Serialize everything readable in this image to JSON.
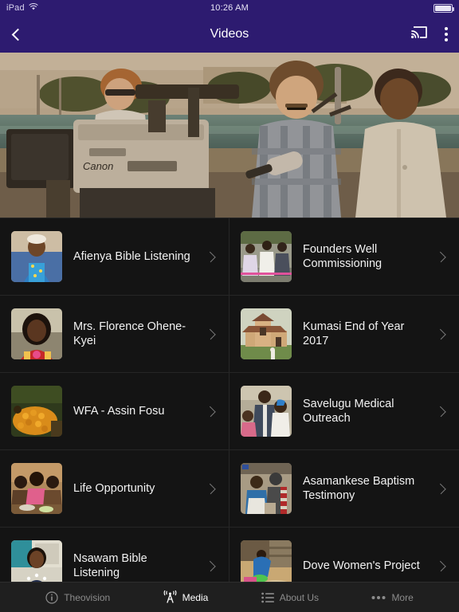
{
  "statusbar": {
    "device": "iPad",
    "wifi_icon": "wifi-icon",
    "time": "10:26 AM",
    "battery_icon": "battery-full-icon"
  },
  "navbar": {
    "back_icon": "back-chevron-icon",
    "menu_icon": "hamburger-menu-icon",
    "title": "Videos",
    "cast_icon": "chromecast-icon",
    "overflow_icon": "overflow-menu-icon"
  },
  "hero": {
    "name": "hero-banner-image",
    "alt": "Vintage photo of a television crew with a Canon studio camera"
  },
  "videos": [
    {
      "title": "Afienya Bible Listening",
      "thumb": "woman-blue-dress-thumbnail"
    },
    {
      "title": "Founders Well Commissioning",
      "thumb": "well-ceremony-crowd-thumbnail"
    },
    {
      "title": "Mrs. Florence Ohene-Kyei",
      "thumb": "woman-portrait-thumbnail"
    },
    {
      "title": "Kumasi End of Year 2017",
      "thumb": "church-building-thumbnail"
    },
    {
      "title": "WFA - Assin Fosu",
      "thumb": "palm-fruit-harvest-thumbnail"
    },
    {
      "title": "Savelugu Medical Outreach",
      "thumb": "medical-outreach-thumbnail"
    },
    {
      "title": "Life Opportunity",
      "thumb": "family-meal-thumbnail"
    },
    {
      "title": "Asamankese Baptism Testimony",
      "thumb": "baptism-testimony-thumbnail"
    },
    {
      "title": "Nsawam Bible Listening",
      "thumb": "woman-polka-dot-thumbnail"
    },
    {
      "title": "Dove Women's Project",
      "thumb": "women-working-thumbnail"
    }
  ],
  "chevron_icon": "chevron-right-icon",
  "tabs": [
    {
      "label": "Theovision",
      "icon": "info-circle-icon",
      "active": false
    },
    {
      "label": "Media",
      "icon": "broadcast-icon",
      "active": true
    },
    {
      "label": "About Us",
      "icon": "list-icon",
      "active": false
    },
    {
      "label": "More",
      "icon": "ellipsis-icon",
      "active": false
    }
  ],
  "colors": {
    "navbar": "#2d1b70",
    "background": "#141414",
    "tabbar": "#1f1f1f",
    "divider": "#262626",
    "active_tab": "#ffffff",
    "inactive_tab": "#8c8c8c"
  }
}
